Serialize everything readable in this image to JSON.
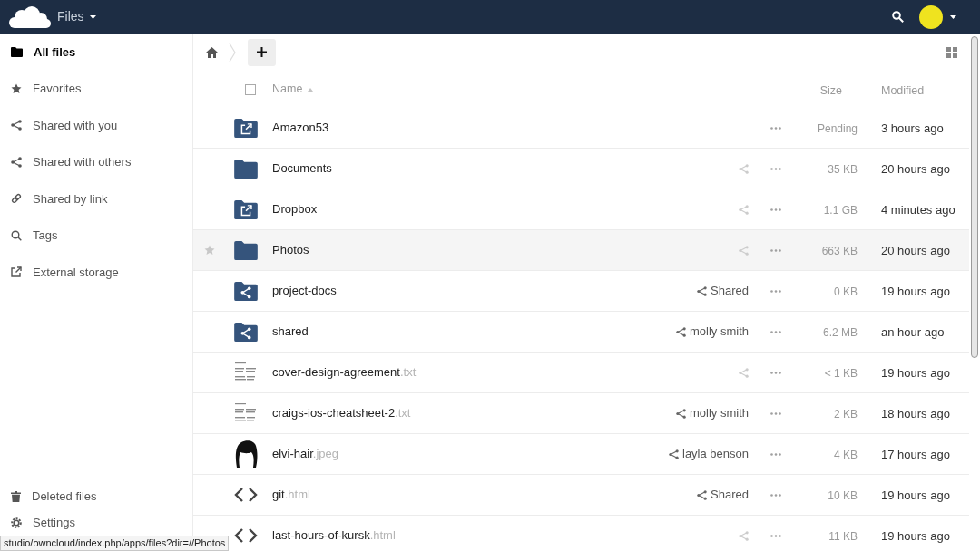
{
  "app_bar": {
    "app_name": "Files"
  },
  "sidebar": {
    "items": [
      {
        "label": "All files",
        "kind": "folder",
        "selected": true
      },
      {
        "label": "Favorites",
        "kind": "star",
        "selected": false
      },
      {
        "label": "Shared with you",
        "kind": "share",
        "selected": false
      },
      {
        "label": "Shared with others",
        "kind": "share",
        "selected": false
      },
      {
        "label": "Shared by link",
        "kind": "link",
        "selected": false
      },
      {
        "label": "Tags",
        "kind": "magnifier",
        "selected": false
      },
      {
        "label": "External storage",
        "kind": "external",
        "selected": false
      }
    ],
    "footer_items": [
      {
        "label": "Deleted files",
        "kind": "trash",
        "selected": false
      },
      {
        "label": "Settings",
        "kind": "gear",
        "selected": false
      }
    ]
  },
  "file_list": {
    "header": {
      "checked": false,
      "name": "Name",
      "size": "Size",
      "modified": "Modified"
    },
    "rows": [
      {
        "kind": "external-folder",
        "name": "Amazon53",
        "highlighted": false,
        "shareable": false,
        "size": "Pending",
        "modified": "3 hours ago"
      },
      {
        "kind": "folder",
        "name": "Documents",
        "highlighted": false,
        "shareable": true,
        "size": "35 KB",
        "modified": "20 hours ago"
      },
      {
        "kind": "external-folder",
        "name": "Dropbox",
        "highlighted": false,
        "shareable": true,
        "size": "1.1 GB",
        "modified": "4 minutes ago"
      },
      {
        "kind": "folder",
        "name": "Photos",
        "highlighted": true,
        "shareable": true,
        "size": "663 KB",
        "modified": "20 hours ago"
      },
      {
        "kind": "shared-folder",
        "name": "project-docs",
        "highlighted": false,
        "shareable": true,
        "share_label": "Shared",
        "size": "0 KB",
        "modified": "19 hours ago"
      },
      {
        "kind": "shared-folder",
        "name": "shared",
        "highlighted": false,
        "shareable": true,
        "share_label": "molly smith",
        "size": "6.2 MB",
        "modified": "an hour ago"
      },
      {
        "kind": "text-file",
        "name": "cover-design-agreement",
        "extension": ".txt",
        "highlighted": false,
        "shareable": true,
        "size": "< 1 KB",
        "modified": "19 hours ago"
      },
      {
        "kind": "text-file",
        "name": "craigs-ios-cheatsheet-2",
        "extension": ".txt",
        "highlighted": false,
        "shareable": true,
        "share_label": "molly smith",
        "size": "2 KB",
        "modified": "18 hours ago"
      },
      {
        "kind": "image",
        "name": "elvi-hair",
        "extension": ".jpeg",
        "highlighted": false,
        "shareable": true,
        "share_label": "layla benson",
        "size": "4 KB",
        "modified": "17 hours ago"
      },
      {
        "kind": "code",
        "name": "git",
        "extension": ".html",
        "highlighted": false,
        "shareable": true,
        "share_label": "Shared",
        "size": "10 KB",
        "modified": "19 hours ago"
      },
      {
        "kind": "code",
        "name": "last-hours-of-kursk",
        "extension": ".html",
        "highlighted": false,
        "shareable": true,
        "size": "11 KB",
        "modified": "19 hours ago"
      }
    ]
  },
  "status_url": "studio/owncloud/index.php/apps/files?dir=//Photos"
}
